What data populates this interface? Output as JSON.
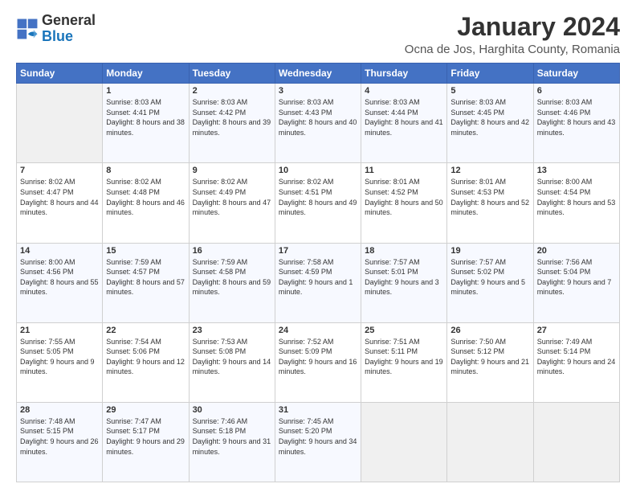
{
  "logo": {
    "text_general": "General",
    "text_blue": "Blue"
  },
  "header": {
    "month_year": "January 2024",
    "location": "Ocna de Jos, Harghita County, Romania"
  },
  "weekdays": [
    "Sunday",
    "Monday",
    "Tuesday",
    "Wednesday",
    "Thursday",
    "Friday",
    "Saturday"
  ],
  "weeks": [
    [
      {
        "day": "",
        "sunrise": "",
        "sunset": "",
        "daylight": ""
      },
      {
        "day": "1",
        "sunrise": "Sunrise: 8:03 AM",
        "sunset": "Sunset: 4:41 PM",
        "daylight": "Daylight: 8 hours and 38 minutes."
      },
      {
        "day": "2",
        "sunrise": "Sunrise: 8:03 AM",
        "sunset": "Sunset: 4:42 PM",
        "daylight": "Daylight: 8 hours and 39 minutes."
      },
      {
        "day": "3",
        "sunrise": "Sunrise: 8:03 AM",
        "sunset": "Sunset: 4:43 PM",
        "daylight": "Daylight: 8 hours and 40 minutes."
      },
      {
        "day": "4",
        "sunrise": "Sunrise: 8:03 AM",
        "sunset": "Sunset: 4:44 PM",
        "daylight": "Daylight: 8 hours and 41 minutes."
      },
      {
        "day": "5",
        "sunrise": "Sunrise: 8:03 AM",
        "sunset": "Sunset: 4:45 PM",
        "daylight": "Daylight: 8 hours and 42 minutes."
      },
      {
        "day": "6",
        "sunrise": "Sunrise: 8:03 AM",
        "sunset": "Sunset: 4:46 PM",
        "daylight": "Daylight: 8 hours and 43 minutes."
      }
    ],
    [
      {
        "day": "7",
        "sunrise": "Sunrise: 8:02 AM",
        "sunset": "Sunset: 4:47 PM",
        "daylight": "Daylight: 8 hours and 44 minutes."
      },
      {
        "day": "8",
        "sunrise": "Sunrise: 8:02 AM",
        "sunset": "Sunset: 4:48 PM",
        "daylight": "Daylight: 8 hours and 46 minutes."
      },
      {
        "day": "9",
        "sunrise": "Sunrise: 8:02 AM",
        "sunset": "Sunset: 4:49 PM",
        "daylight": "Daylight: 8 hours and 47 minutes."
      },
      {
        "day": "10",
        "sunrise": "Sunrise: 8:02 AM",
        "sunset": "Sunset: 4:51 PM",
        "daylight": "Daylight: 8 hours and 49 minutes."
      },
      {
        "day": "11",
        "sunrise": "Sunrise: 8:01 AM",
        "sunset": "Sunset: 4:52 PM",
        "daylight": "Daylight: 8 hours and 50 minutes."
      },
      {
        "day": "12",
        "sunrise": "Sunrise: 8:01 AM",
        "sunset": "Sunset: 4:53 PM",
        "daylight": "Daylight: 8 hours and 52 minutes."
      },
      {
        "day": "13",
        "sunrise": "Sunrise: 8:00 AM",
        "sunset": "Sunset: 4:54 PM",
        "daylight": "Daylight: 8 hours and 53 minutes."
      }
    ],
    [
      {
        "day": "14",
        "sunrise": "Sunrise: 8:00 AM",
        "sunset": "Sunset: 4:56 PM",
        "daylight": "Daylight: 8 hours and 55 minutes."
      },
      {
        "day": "15",
        "sunrise": "Sunrise: 7:59 AM",
        "sunset": "Sunset: 4:57 PM",
        "daylight": "Daylight: 8 hours and 57 minutes."
      },
      {
        "day": "16",
        "sunrise": "Sunrise: 7:59 AM",
        "sunset": "Sunset: 4:58 PM",
        "daylight": "Daylight: 8 hours and 59 minutes."
      },
      {
        "day": "17",
        "sunrise": "Sunrise: 7:58 AM",
        "sunset": "Sunset: 4:59 PM",
        "daylight": "Daylight: 9 hours and 1 minute."
      },
      {
        "day": "18",
        "sunrise": "Sunrise: 7:57 AM",
        "sunset": "Sunset: 5:01 PM",
        "daylight": "Daylight: 9 hours and 3 minutes."
      },
      {
        "day": "19",
        "sunrise": "Sunrise: 7:57 AM",
        "sunset": "Sunset: 5:02 PM",
        "daylight": "Daylight: 9 hours and 5 minutes."
      },
      {
        "day": "20",
        "sunrise": "Sunrise: 7:56 AM",
        "sunset": "Sunset: 5:04 PM",
        "daylight": "Daylight: 9 hours and 7 minutes."
      }
    ],
    [
      {
        "day": "21",
        "sunrise": "Sunrise: 7:55 AM",
        "sunset": "Sunset: 5:05 PM",
        "daylight": "Daylight: 9 hours and 9 minutes."
      },
      {
        "day": "22",
        "sunrise": "Sunrise: 7:54 AM",
        "sunset": "Sunset: 5:06 PM",
        "daylight": "Daylight: 9 hours and 12 minutes."
      },
      {
        "day": "23",
        "sunrise": "Sunrise: 7:53 AM",
        "sunset": "Sunset: 5:08 PM",
        "daylight": "Daylight: 9 hours and 14 minutes."
      },
      {
        "day": "24",
        "sunrise": "Sunrise: 7:52 AM",
        "sunset": "Sunset: 5:09 PM",
        "daylight": "Daylight: 9 hours and 16 minutes."
      },
      {
        "day": "25",
        "sunrise": "Sunrise: 7:51 AM",
        "sunset": "Sunset: 5:11 PM",
        "daylight": "Daylight: 9 hours and 19 minutes."
      },
      {
        "day": "26",
        "sunrise": "Sunrise: 7:50 AM",
        "sunset": "Sunset: 5:12 PM",
        "daylight": "Daylight: 9 hours and 21 minutes."
      },
      {
        "day": "27",
        "sunrise": "Sunrise: 7:49 AM",
        "sunset": "Sunset: 5:14 PM",
        "daylight": "Daylight: 9 hours and 24 minutes."
      }
    ],
    [
      {
        "day": "28",
        "sunrise": "Sunrise: 7:48 AM",
        "sunset": "Sunset: 5:15 PM",
        "daylight": "Daylight: 9 hours and 26 minutes."
      },
      {
        "day": "29",
        "sunrise": "Sunrise: 7:47 AM",
        "sunset": "Sunset: 5:17 PM",
        "daylight": "Daylight: 9 hours and 29 minutes."
      },
      {
        "day": "30",
        "sunrise": "Sunrise: 7:46 AM",
        "sunset": "Sunset: 5:18 PM",
        "daylight": "Daylight: 9 hours and 31 minutes."
      },
      {
        "day": "31",
        "sunrise": "Sunrise: 7:45 AM",
        "sunset": "Sunset: 5:20 PM",
        "daylight": "Daylight: 9 hours and 34 minutes."
      },
      {
        "day": "",
        "sunrise": "",
        "sunset": "",
        "daylight": ""
      },
      {
        "day": "",
        "sunrise": "",
        "sunset": "",
        "daylight": ""
      },
      {
        "day": "",
        "sunrise": "",
        "sunset": "",
        "daylight": ""
      }
    ]
  ]
}
